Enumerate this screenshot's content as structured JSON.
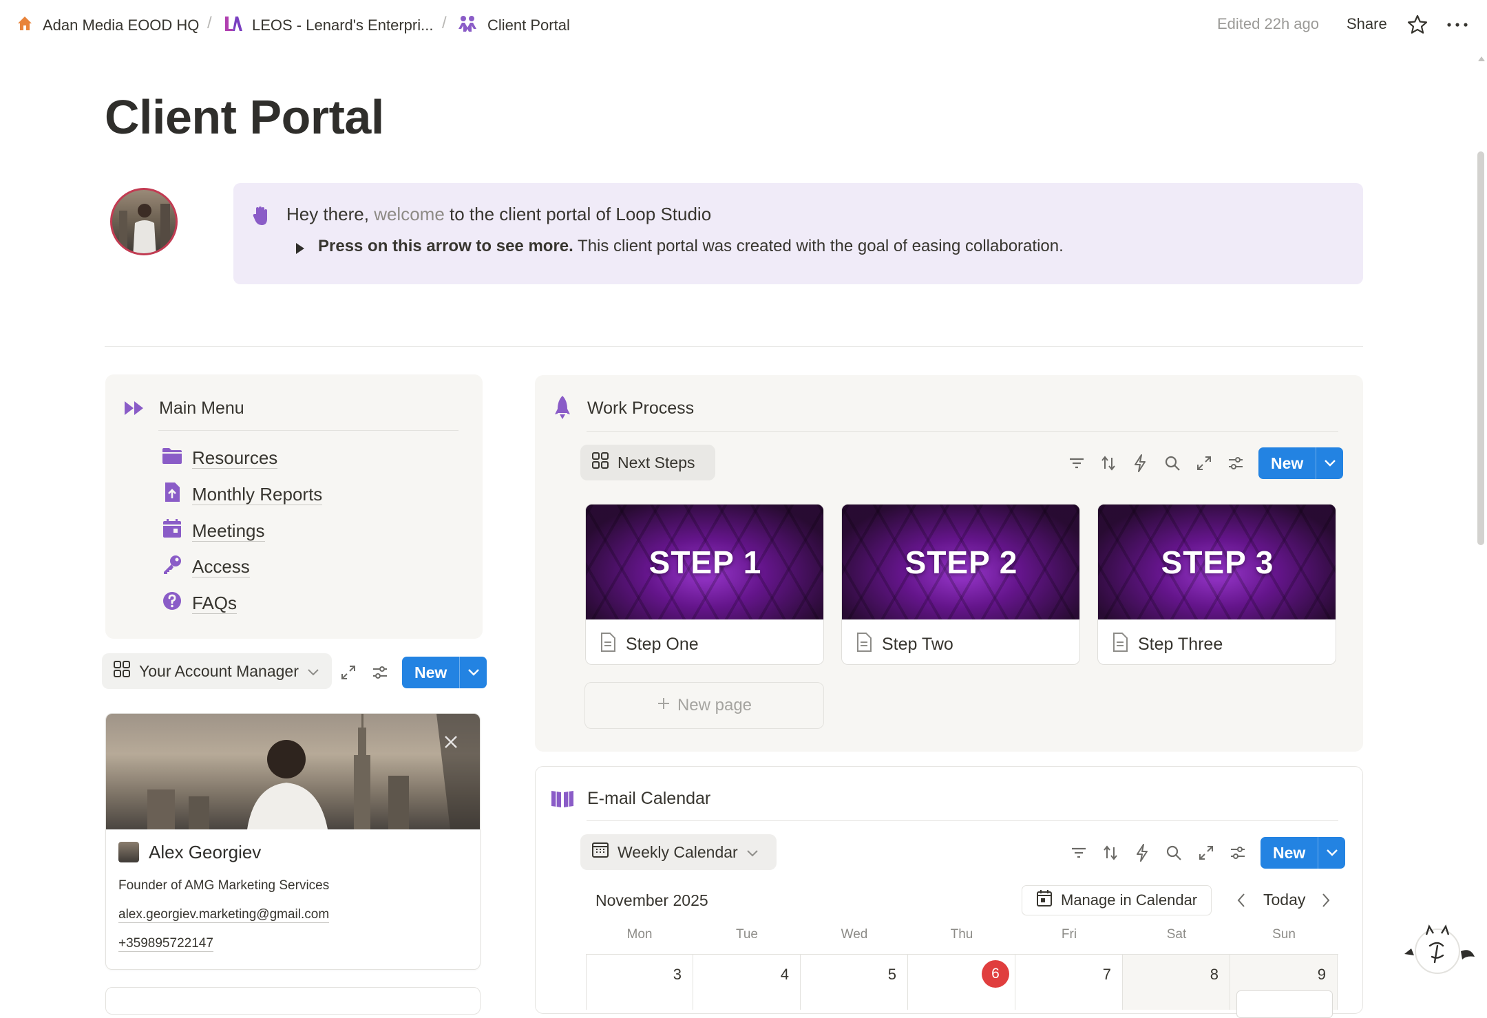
{
  "breadcrumb": [
    {
      "label": "Adan Media EOOD HQ",
      "icon": "house-icon"
    },
    {
      "label": "LEOS - Lenard's Enterpri...",
      "icon": "leos-logo-icon"
    },
    {
      "label": "Client Portal",
      "icon": "people-icon"
    }
  ],
  "topbar": {
    "edited": "Edited 22h ago",
    "share": "Share"
  },
  "page": {
    "title": "Client Portal"
  },
  "callout": {
    "hey": "Hey there,",
    "welcome": "welcome",
    "rest": "to the client portal of Loop Studio",
    "toggle_bold": "Press on this arrow to see more.",
    "toggle_rest": "This client portal was created with the goal of easing collaboration."
  },
  "main_menu": {
    "title": "Main Menu",
    "items": [
      {
        "label": "Resources",
        "icon": "folder-icon"
      },
      {
        "label": "Monthly Reports",
        "icon": "report-upload-icon"
      },
      {
        "label": "Meetings",
        "icon": "calendar-icon"
      },
      {
        "label": "Access",
        "icon": "key-icon"
      },
      {
        "label": "FAQs",
        "icon": "question-icon"
      }
    ]
  },
  "account_manager": {
    "view_label": "Your Account Manager",
    "new_label": "New",
    "name": "Alex Georgiev",
    "role": "Founder of AMG Marketing Services",
    "email": "alex.georgiev.marketing@gmail.com",
    "phone": "+359895722147"
  },
  "work_process": {
    "title": "Work Process",
    "view_label": "Next Steps",
    "new_label": "New",
    "steps": [
      {
        "image_text": "STEP 1",
        "title": "Step One"
      },
      {
        "image_text": "STEP 2",
        "title": "Step Two"
      },
      {
        "image_text": "STEP 3",
        "title": "Step Three"
      }
    ],
    "new_page": "New page"
  },
  "email_calendar": {
    "title": "E-mail Calendar",
    "view_label": "Weekly Calendar",
    "new_label": "New",
    "month": "November 2025",
    "manage": "Manage in Calendar",
    "today": "Today",
    "weekdays": [
      "Mon",
      "Tue",
      "Wed",
      "Thu",
      "Fri",
      "Sat",
      "Sun"
    ],
    "days": [
      "3",
      "4",
      "5",
      "6",
      "7",
      "8",
      "9"
    ],
    "today_day": "6"
  },
  "colors": {
    "accent_purple": "#8a5cc7",
    "callout_bg": "#f0ebf8",
    "primary_blue": "#2383e2",
    "today_red": "#e03e3e"
  }
}
